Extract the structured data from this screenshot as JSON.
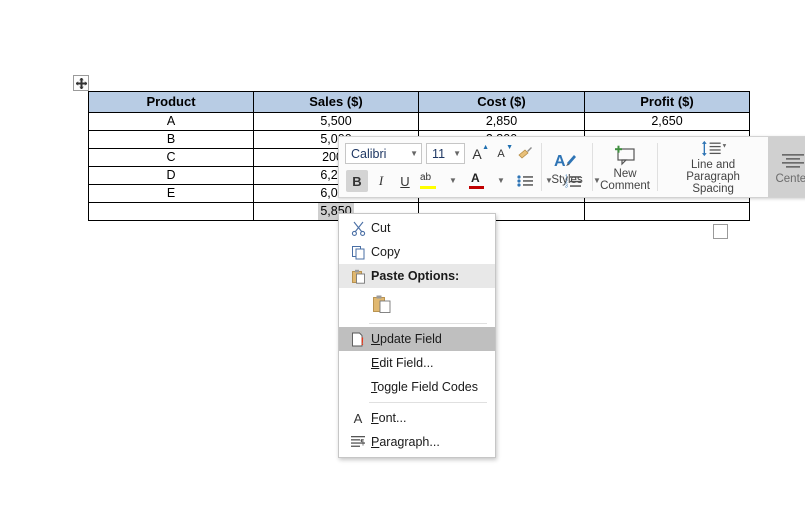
{
  "document": {
    "table": {
      "headers": [
        "Product",
        "Sales ($)",
        "Cost ($)",
        "Profit ($)"
      ],
      "header_bg": "#b8cce4",
      "rows": [
        {
          "product": "A",
          "sales": "5,500",
          "cost": "2,850",
          "profit": "2,650"
        },
        {
          "product": "B",
          "sales": "5,000",
          "cost": "2,800",
          "profit": ""
        },
        {
          "product": "C",
          "sales": "2000",
          "cost": "",
          "profit": ""
        },
        {
          "product": "D",
          "sales": "6,250",
          "cost": "",
          "profit": ""
        },
        {
          "product": "E",
          "sales": "6,000",
          "cost": "",
          "profit": ""
        }
      ],
      "total_row": {
        "product": "",
        "sales": "5,850",
        "cost": "",
        "profit": ""
      },
      "selected_field_value": "5,850",
      "selected_field_bg": "#cfcfcf"
    },
    "move_handle_icon": "move-cross-icon",
    "resize_handle_icon": "resize-square-icon"
  },
  "mini_toolbar": {
    "font_name": "Calibri",
    "font_size": "11",
    "grow_font_icon": "grow-font-icon",
    "shrink_font_icon": "shrink-font-icon",
    "format_painter_icon": "format-painter-icon",
    "bold_label": "B",
    "italic_label": "I",
    "underline_label": "U",
    "highlight_icon": "text-highlight-icon",
    "font_color_icon": "font-color-icon",
    "bullets_icon": "bullet-list-icon",
    "numbering_icon": "numbered-list-icon",
    "styles": {
      "icon": "styles-icon",
      "label": "Styles"
    },
    "new_comment": {
      "icon": "new-comment-icon",
      "label_line1": "New",
      "label_line2": "Comment"
    },
    "line_spacing": {
      "icon": "line-spacing-icon",
      "label_line1": "Line and Paragraph",
      "label_line2": "Spacing"
    },
    "center": {
      "icon": "align-center-icon",
      "label": "Center"
    },
    "highlight_color": "#ffff00",
    "font_color": "#c00000"
  },
  "context_menu": {
    "items": [
      {
        "id": "cut",
        "icon": "scissors-icon",
        "label": "Cut",
        "accel": "t",
        "type": "item"
      },
      {
        "id": "copy",
        "icon": "copy-icon",
        "label": "Copy",
        "accel": "C",
        "type": "item"
      },
      {
        "id": "paste-options",
        "icon": "clipboard-icon",
        "label": "Paste Options:",
        "type": "header"
      },
      {
        "id": "paste-keep-text",
        "icon": "paste-keep-text-icon",
        "label": "",
        "type": "iconstrip"
      },
      {
        "id": "update-field",
        "icon": "update-field-icon",
        "label": "Update Field",
        "accel": "U",
        "type": "item",
        "selected": true
      },
      {
        "id": "edit-field",
        "icon": "",
        "label": "Edit Field...",
        "accel": "E",
        "type": "item"
      },
      {
        "id": "toggle-field-codes",
        "icon": "",
        "label": "Toggle Field Codes",
        "accel": "T",
        "type": "item"
      },
      {
        "id": "font",
        "icon": "font-A-icon",
        "label": "Font...",
        "accel": "F",
        "type": "item"
      },
      {
        "id": "paragraph",
        "icon": "paragraph-icon",
        "label": "Paragraph...",
        "accel": "P",
        "type": "item"
      }
    ],
    "highlight_bg": "#bfbfbf"
  }
}
